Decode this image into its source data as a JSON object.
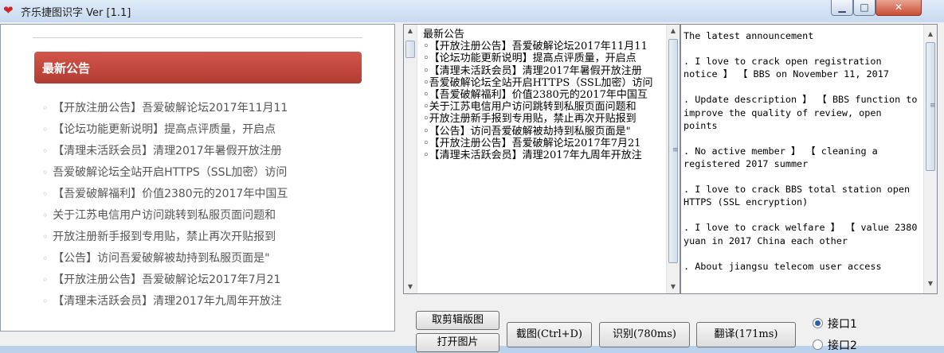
{
  "window": {
    "title": "齐乐捷图识字 Ver [1.1]",
    "app_icon": "heart-icon",
    "accent": "#c24a40"
  },
  "webview": {
    "panel_title": "最新公告",
    "items": [
      "【开放注册公告】吾爱破解论坛2017年11月11",
      "【论坛功能更新说明】提高点评质量，开启点",
      "【清理未活跃会员】清理2017年暑假开放注册",
      "吾爱破解论坛全站开启HTTPS（SSL加密）访问",
      "【吾爱破解福利】价值2380元的2017年中国互",
      "关于江苏电信用户访问跳转到私服页面问题和",
      "开放注册新手报到专用贴，禁止再次开贴报到",
      "【公告】访问吾爱破解被劫持到私服页面是\"",
      "【开放注册公告】吾爱破解论坛2017年7月21",
      "【清理未活跃会员】清理2017年九周年开放注"
    ]
  },
  "ocr_text": "最新公告\n◦【开放注册公告】吾爱破解论坛2017年11月11\n◦【论坛功能更新说明】提高点评质量，开启点\n◦【清理未活跃会员】清理2017年暑假开放注册\n◦吾爱破解论坛全站开启HTTPS（SSL加密）访问\n◦【吾爱破解福利】价值2380元的2017年中国互\n◦关于江苏电信用户访问跳转到私服页面问题和\n◦开放注册新手报到专用贴，禁止再次开贴报到\n◦【公告】访问吾爱破解被劫持到私服页面是\"\n◦【开放注册公告】吾爱破解论坛2017年7月21\n◦【清理未活跃会员】清理2017年九周年开放注",
  "translation_text": "The latest announcement\n\n. I love to crack open registration notice 】 【 BBS on November 11, 2017\n\n. Update description 】 【 BBS function to improve the quality of review, open points\n\n. No active member 】 【 cleaning a registered 2017 summer\n\n. I love to crack BBS total station open HTTPS (SSL encryption)\n\n. I love to crack welfare 】 【 value 2380 yuan in 2017 China each other\n\n. About jiangsu telecom user access",
  "buttons": {
    "crop": "取剪辑版图",
    "open": "打开图片",
    "capture": "截图(Ctrl+D)",
    "recognize": "识别(780ms)",
    "translate": "翻译(171ms)"
  },
  "radios": [
    {
      "label": "接口1",
      "selected": true
    },
    {
      "label": "接口2",
      "selected": false
    }
  ]
}
